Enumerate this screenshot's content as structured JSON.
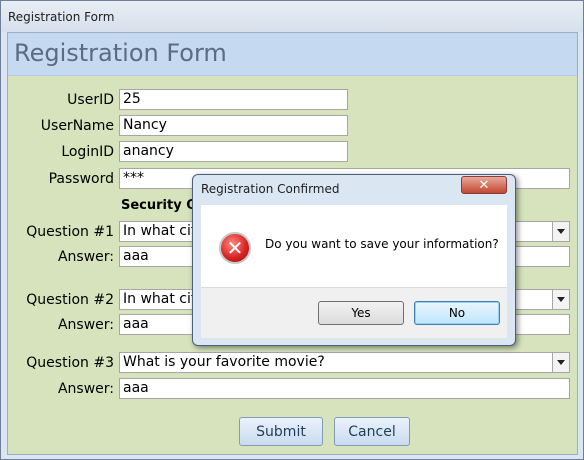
{
  "window": {
    "title": "Registration Form"
  },
  "form": {
    "header": "Registration Form",
    "fields": {
      "userid": {
        "label": "UserID",
        "value": "25"
      },
      "username": {
        "label": "UserName",
        "value": "Nancy"
      },
      "loginid": {
        "label": "LoginID",
        "value": "anancy"
      },
      "password": {
        "label": "Password",
        "value": "***"
      }
    },
    "security_header": "Security Que",
    "questions": [
      {
        "label": "Question #1",
        "value": "In what city",
        "answer_label": "Answer:",
        "answer": "aaa"
      },
      {
        "label": "Question #2",
        "value": "In what city",
        "answer_label": "Answer:",
        "answer": "aaa"
      },
      {
        "label": "Question #3",
        "value": "What is your favorite movie?",
        "answer_label": "Answer:",
        "answer": "aaa"
      }
    ],
    "submit_label": "Submit",
    "cancel_label": "Cancel"
  },
  "dialog": {
    "title": "Registration Confirmed",
    "close_glyph": "✕",
    "icon": "error-icon",
    "icon_glyph": "✕",
    "message": "Do you want to save your information?",
    "yes_label": "Yes",
    "no_label": "No"
  }
}
